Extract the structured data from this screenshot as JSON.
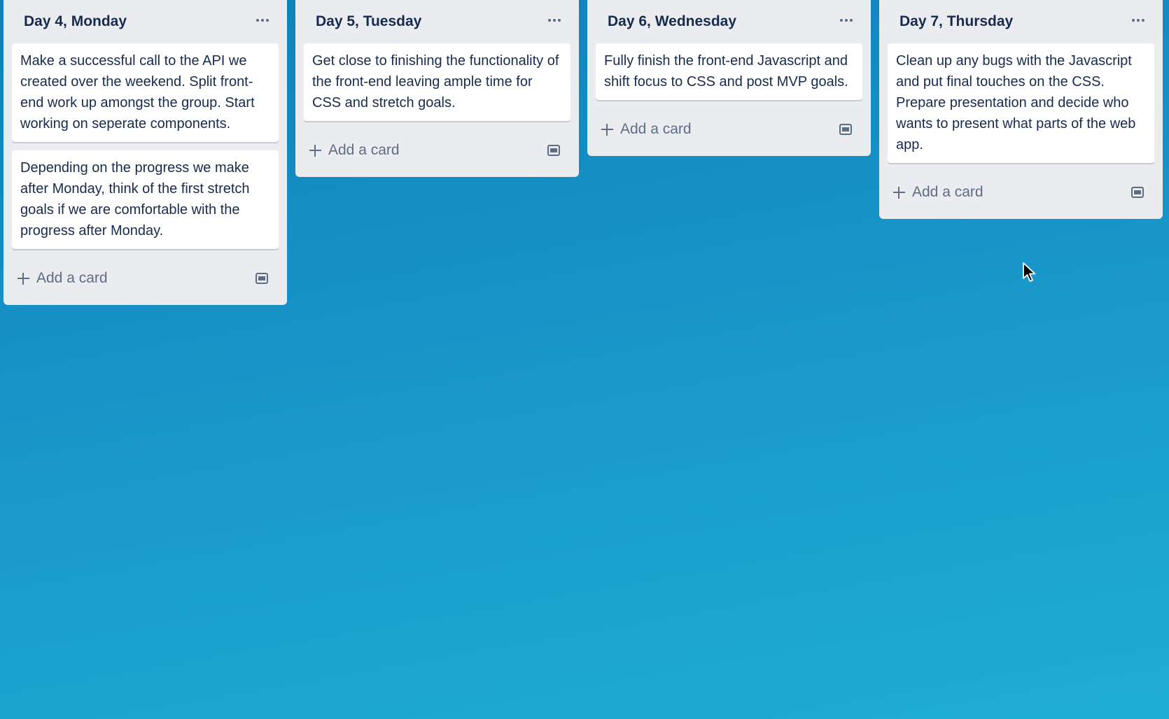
{
  "lists": [
    {
      "title": "Day 4, Monday",
      "cards": [
        "Make a successful call to the API we created over the weekend. Split front-end work up amongst the group. Start working on seperate components.",
        "Depending on the progress we make after Monday, think of the first stretch goals if we are comfortable with the progress after Monday."
      ],
      "add_card_label": "Add a card"
    },
    {
      "title": "Day 5, Tuesday",
      "cards": [
        "Get close to finishing the functionality of the front-end leaving ample time for CSS and stretch goals."
      ],
      "add_card_label": "Add a card"
    },
    {
      "title": "Day 6, Wednesday",
      "cards": [
        "Fully finish the front-end Javascript and shift focus to CSS and post MVP goals."
      ],
      "add_card_label": "Add a card"
    },
    {
      "title": "Day 7, Thursday",
      "cards": [
        "Clean up any bugs with the Javascript and put final touches on the CSS. Prepare presentation and decide who wants to present what parts of the web app."
      ],
      "add_card_label": "Add a card"
    }
  ],
  "icons": {
    "list_menu": "more-horizontal-icon",
    "add": "plus-icon",
    "template": "card-template-icon",
    "cursor": "mouse-pointer-icon"
  },
  "colors": {
    "background_top": "#0f7fbd",
    "background_bottom": "#1eaed3",
    "list_background": "#ebecf0",
    "card_background": "#ffffff",
    "title_text": "#172b4d",
    "muted_text": "#5e6c84"
  }
}
